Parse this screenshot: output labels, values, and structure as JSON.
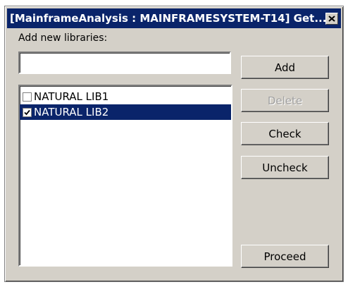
{
  "window": {
    "title": "[MainframeAnalysis : MAINFRAMESYSTEM-T14] Get...",
    "close_icon": "close-icon"
  },
  "form": {
    "add_label": "Add new libraries:",
    "input_value": "",
    "input_placeholder": ""
  },
  "libraries": [
    {
      "name": "NATURAL LIB1",
      "checked": false,
      "selected": false
    },
    {
      "name": "NATURAL LIB2",
      "checked": true,
      "selected": true
    }
  ],
  "buttons": {
    "add": "Add",
    "delete": "Delete",
    "check": "Check",
    "uncheck": "Uncheck",
    "proceed": "Proceed"
  },
  "states": {
    "delete_enabled": false
  },
  "colors": {
    "title_bar": "#0a246a",
    "dialog_bg": "#d4d0c8",
    "selection": "#0a246a"
  }
}
